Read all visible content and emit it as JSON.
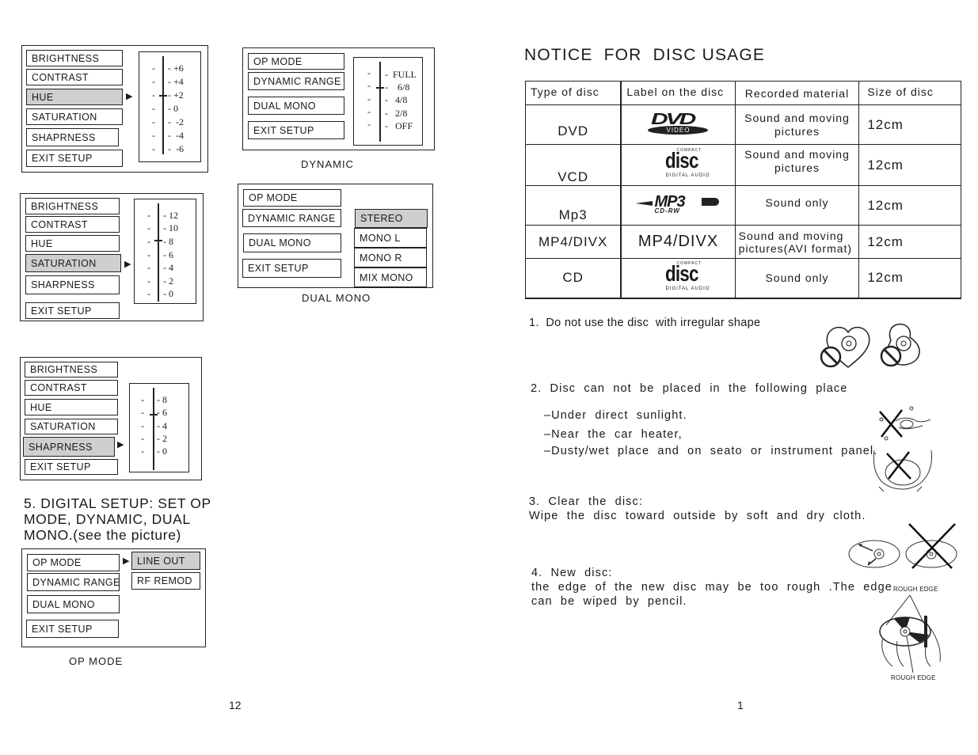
{
  "left_page": {
    "page_number": "12",
    "hue_menu": {
      "items": [
        "BRIGHTNESS",
        "CONTRAST",
        "HUE",
        "SATURATION",
        "SHAPRNESS",
        "EXIT SETUP"
      ],
      "selected": "HUE",
      "scale": [
        "+6",
        "+4",
        "+2",
        "0",
        "-2",
        "-4",
        "-6"
      ],
      "current_value": "+2"
    },
    "saturation_menu": {
      "items": [
        "BRIGHTNESS",
        "CONTRAST",
        "HUE",
        "SATURATION",
        "SHARPNESS",
        "EXIT SETUP"
      ],
      "selected": "SATURATION",
      "scale": [
        "12",
        "10",
        "8",
        "6",
        "4",
        "2",
        "0"
      ],
      "current_value": "8"
    },
    "sharpness_menu": {
      "items": [
        "BRIGHTNESS",
        "CONTRAST",
        "HUE",
        "SATURATION",
        "SHAPRNESS",
        "EXIT SETUP"
      ],
      "selected": "SHAPRNESS",
      "scale": [
        "8",
        "6",
        "4",
        "2",
        "0"
      ],
      "current_value": "5"
    },
    "dynamic_menu": {
      "items": [
        "OP MODE",
        "DYNAMIC RANGE",
        "DUAL MONO",
        "EXIT SETUP"
      ],
      "scale": [
        "FULL",
        "6/8",
        "4/8",
        "2/8",
        "OFF"
      ],
      "current_value": "6/8",
      "caption": "DYNAMIC"
    },
    "dual_mono_menu": {
      "items": [
        "OP MODE",
        "DYNAMIC RANGE",
        "DUAL MONO",
        "EXIT SETUP"
      ],
      "options": [
        "STEREO",
        "MONO L",
        "MONO R",
        "MIX MONO"
      ],
      "selected_option": "STEREO",
      "caption": "DUAL MONO"
    },
    "section_heading": [
      "5. DIGITAL SETUP: SET OP",
      "MODE, DYNAMIC, DUAL",
      "MONO.(see the picture)"
    ],
    "op_mode_menu": {
      "items": [
        "OP MODE",
        "DYNAMIC RANGE",
        "DUAL MONO",
        "EXIT SETUP"
      ],
      "options": [
        "LINE OUT",
        "RF REMOD"
      ],
      "selected_option": "LINE OUT",
      "caption": "OP MODE"
    }
  },
  "right_page": {
    "page_number": "1",
    "title": "NOTICE  FOR  DISC USAGE",
    "table": {
      "headers": [
        "Type  of  disc",
        "Label  on  the  disc",
        "Recorded  material",
        "Size  of  disc"
      ],
      "rows": [
        {
          "type": "DVD",
          "label_logo": "dvd-video-logo",
          "logo_text": "DVD",
          "logo_sub": "VIDEO",
          "material": [
            "Sound  and  moving",
            "pictures"
          ],
          "size": "12cm"
        },
        {
          "type": "VCD",
          "label_logo": "compact-disc-logo",
          "logo_text": "disc",
          "logo_top": "COMPACT",
          "logo_sub": "DIGITAL AUDIO",
          "material": [
            "Sound  and  moving",
            "pictures"
          ],
          "size": "12cm"
        },
        {
          "type": "Mp3",
          "label_logo": "mp3-cdrw-logo",
          "logo_text": "MP3",
          "logo_sub": "CD-RW",
          "material": [
            "Sound  only"
          ],
          "size": "12cm"
        },
        {
          "type": "MP4/DIVX",
          "label_logo": "mp4-divx-text",
          "logo_text": "MP4/DIVX",
          "material": [
            "Sound  and  moving",
            "pictures(AVI  format)"
          ],
          "size": "12cm"
        },
        {
          "type": "CD",
          "label_logo": "compact-disc-logo",
          "logo_text": "disc",
          "logo_top": "COMPACT",
          "logo_sub": "DIGITAL AUDIO",
          "material": [
            "Sound  only"
          ],
          "size": "12cm"
        }
      ]
    },
    "notices": {
      "n1": "1.  Do not use the disc  with irregular shape",
      "n2": "2.  Disc  can  not  be  placed  in  the  following  place",
      "n2_items": [
        "–Under  direct  sunlight.",
        "–Near  the  car  heater,",
        "–Dusty/wet  place  and  on  seato  or  instrument  panel."
      ],
      "n3_title": "3.  Clear  the  disc:",
      "n3_text": "Wipe  the  disc  toward  outside  by  soft  and  dry  cloth.",
      "n4_title": "4.  New  disc:",
      "n4_line1": "the  edge  of  the  new  disc  may  be  too  rough  .The  edge",
      "n4_line2": "can  be  wiped  by  pencil.",
      "rough_edge_top": "ROUGH EDGE",
      "rough_edge_bottom": "ROUGH EDGE"
    }
  }
}
